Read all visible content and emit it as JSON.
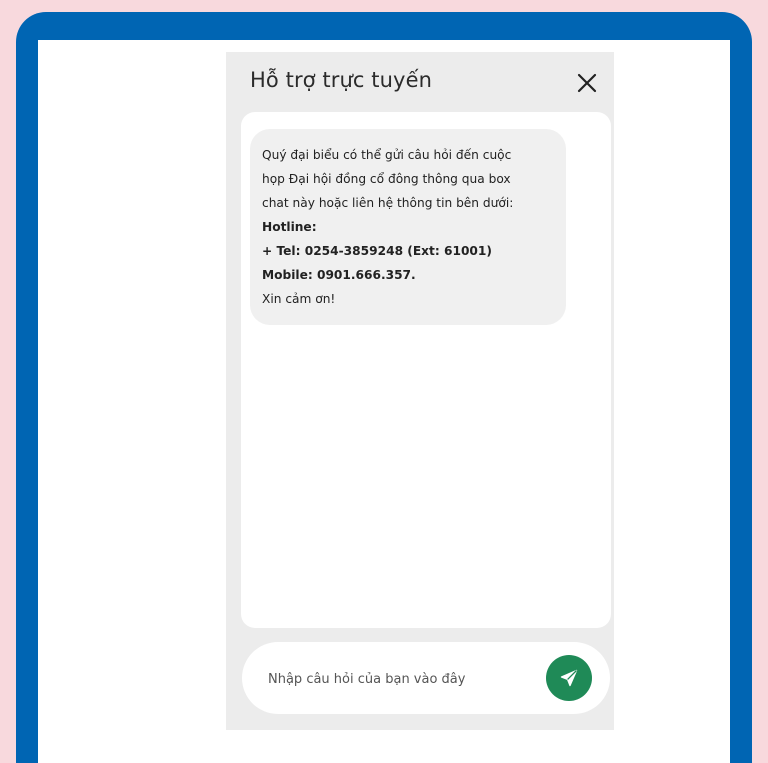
{
  "chat": {
    "title": "Hỗ trợ trực tuyến",
    "message_lines": [
      "Quý đại biểu có thể gửi câu hỏi đến cuộc",
      "họp Đại hội đồng cổ đông thông qua box",
      "chat này hoặc liên hệ thông tin bên dưới:",
      "Hotline:",
      "+ Tel: 0254-3859248 (Ext: 61001)",
      "Mobile: 0901.666.357.",
      "Xin cảm ơn!"
    ],
    "input": {
      "placeholder": "Nhập câu hỏi của bạn vào đây",
      "value": ""
    },
    "icons": {
      "close": "close-icon",
      "send": "send-icon"
    }
  },
  "colors": {
    "page_background": "#f8d9dd",
    "frame": "#0065b3",
    "send_button": "#1f8a57"
  }
}
